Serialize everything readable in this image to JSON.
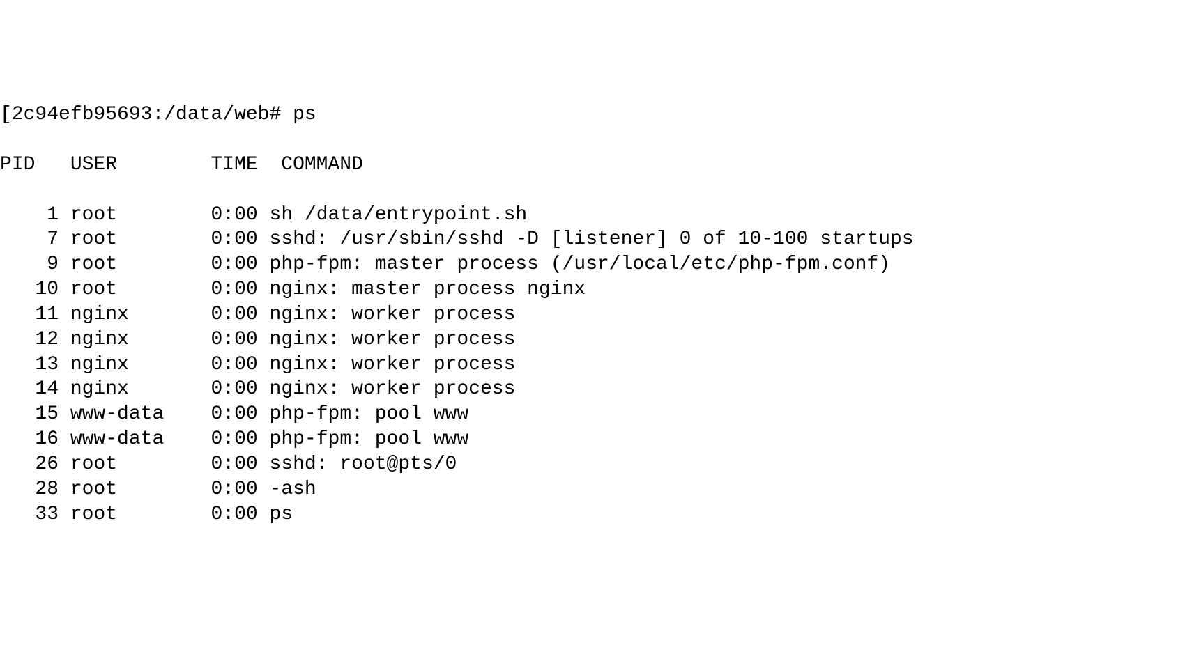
{
  "terminal": {
    "prompt": {
      "bracket": "[",
      "host_path": "2c94efb95693:/data/web# ",
      "command": "ps"
    },
    "header": {
      "pid": "PID",
      "user": "USER",
      "time": "TIME",
      "command": "COMMAND"
    },
    "rows": [
      {
        "pid": "1",
        "user": "root",
        "time": "0:00",
        "command": "sh /data/entrypoint.sh"
      },
      {
        "pid": "7",
        "user": "root",
        "time": "0:00",
        "command": "sshd: /usr/sbin/sshd -D [listener] 0 of 10-100 startups"
      },
      {
        "pid": "9",
        "user": "root",
        "time": "0:00",
        "command": "php-fpm: master process (/usr/local/etc/php-fpm.conf)"
      },
      {
        "pid": "10",
        "user": "root",
        "time": "0:00",
        "command": "nginx: master process nginx"
      },
      {
        "pid": "11",
        "user": "nginx",
        "time": "0:00",
        "command": "nginx: worker process"
      },
      {
        "pid": "12",
        "user": "nginx",
        "time": "0:00",
        "command": "nginx: worker process"
      },
      {
        "pid": "13",
        "user": "nginx",
        "time": "0:00",
        "command": "nginx: worker process"
      },
      {
        "pid": "14",
        "user": "nginx",
        "time": "0:00",
        "command": "nginx: worker process"
      },
      {
        "pid": "15",
        "user": "www-data",
        "time": "0:00",
        "command": "php-fpm: pool www"
      },
      {
        "pid": "16",
        "user": "www-data",
        "time": "0:00",
        "command": "php-fpm: pool www"
      },
      {
        "pid": "26",
        "user": "root",
        "time": "0:00",
        "command": "sshd: root@pts/0"
      },
      {
        "pid": "28",
        "user": "root",
        "time": "0:00",
        "command": "-ash"
      },
      {
        "pid": "33",
        "user": "root",
        "time": "0:00",
        "command": "ps"
      }
    ]
  }
}
